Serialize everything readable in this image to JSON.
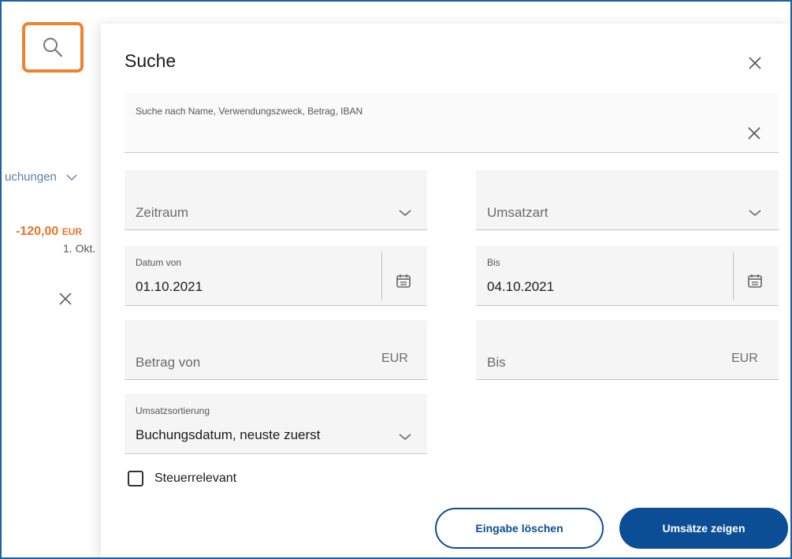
{
  "background": {
    "bookings_link": "uchungen",
    "amount": "-120,00",
    "currency": "EUR",
    "date": "1. Okt."
  },
  "search_panel": {
    "title": "Suche",
    "search_label": "Suche nach Name, Verwendungszweck, Betrag, IBAN",
    "search_value": "",
    "period_placeholder": "Zeitraum",
    "transaction_type_placeholder": "Umsatzart",
    "date_from_label": "Datum von",
    "date_from_value": "01.10.2021",
    "date_to_label": "Bis",
    "date_to_value": "04.10.2021",
    "amount_from_placeholder": "Betrag von",
    "amount_to_placeholder": "Bis",
    "amount_currency": "EUR",
    "sort_label": "Umsatzsortierung",
    "sort_value": "Buchungsdatum, neuste zuerst",
    "tax_relevant_label": "Steuerrelevant",
    "tax_relevant_checked": false,
    "clear_button": "Eingabe löschen",
    "show_button": "Umsätze zeigen"
  },
  "colors": {
    "accent": "#0b4e96",
    "highlight": "#f0822d",
    "amount_negative": "#e8742a",
    "frame": "#1f5fa8"
  },
  "icons": [
    "search-icon",
    "close-icon",
    "chevron-down-icon",
    "calendar-icon"
  ]
}
